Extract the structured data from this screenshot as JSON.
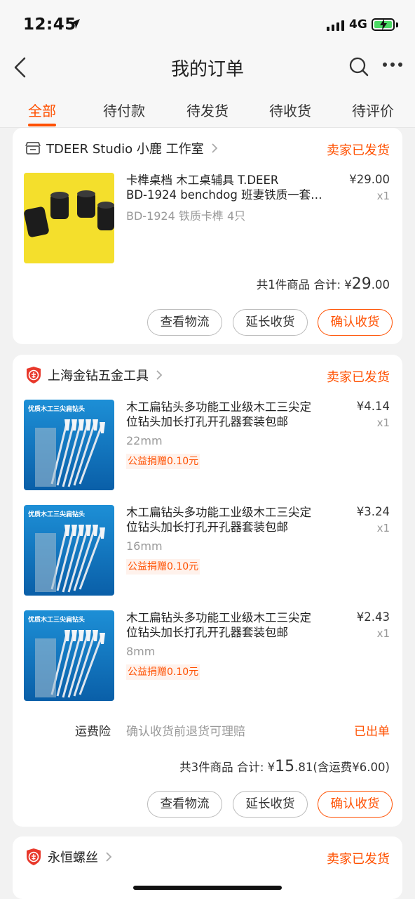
{
  "status_bar": {
    "time": "12:45",
    "network": "4G"
  },
  "nav": {
    "title": "我的订单"
  },
  "tabs": [
    {
      "label": "全部",
      "active": true
    },
    {
      "label": "待付款",
      "active": false
    },
    {
      "label": "待发货",
      "active": false
    },
    {
      "label": "待收货",
      "active": false
    },
    {
      "label": "待评价",
      "active": false
    }
  ],
  "orders": [
    {
      "shop": "TDEER Studio 小鹿 工作室",
      "status": "卖家已发货",
      "items": [
        {
          "title_line1": "卡榫桌档 木工桌辅具 T.DEER",
          "title_line2": "BD-1924 benchdog 班妻铁质一套…",
          "spec": "BD-1924 铁质卡榫 4只",
          "price": "¥29.00",
          "qty": "x1"
        }
      ],
      "summary_prefix": "共1件商品 合计: ¥",
      "summary_amount_int": "29",
      "summary_amount_dec": ".00",
      "buttons": {
        "logistics": "查看物流",
        "extend": "延长收货",
        "confirm": "确认收货"
      }
    },
    {
      "shop": "上海金钻五金工具",
      "status": "卖家已发货",
      "items": [
        {
          "title_line1": "木工扁钻头多功能工业级木工三尖定",
          "title_line2": "位钻头加长打孔开孔器套装包邮",
          "spec": "22mm",
          "price": "¥4.14",
          "qty": "x1",
          "charity": "公益捐赠0.10元"
        },
        {
          "title_line1": "木工扁钻头多功能工业级木工三尖定",
          "title_line2": "位钻头加长打孔开孔器套装包邮",
          "spec": "16mm",
          "price": "¥3.24",
          "qty": "x1",
          "charity": "公益捐赠0.10元"
        },
        {
          "title_line1": "木工扁钻头多功能工业级木工三尖定",
          "title_line2": "位钻头加长打孔开孔器套装包邮",
          "spec": "8mm",
          "price": "¥2.43",
          "qty": "x1",
          "charity": "公益捐赠0.10元"
        }
      ],
      "thumb_text_line1": "优质木工三尖扁钻头",
      "insurance": {
        "label": "运费险",
        "text": "确认收货前退货可理赔",
        "status": "已出单"
      },
      "summary_prefix": "共3件商品 合计: ¥",
      "summary_amount_int": "15",
      "summary_amount_dec": ".81",
      "summary_suffix": "(含运费¥6.00)",
      "buttons": {
        "logistics": "查看物流",
        "extend": "延长收货",
        "confirm": "确认收货"
      }
    },
    {
      "shop": "永恒螺丝",
      "status": "卖家已发货"
    }
  ],
  "colors": {
    "accent": "#ff5000",
    "background": "#f2f2f2",
    "card": "#ffffff"
  }
}
